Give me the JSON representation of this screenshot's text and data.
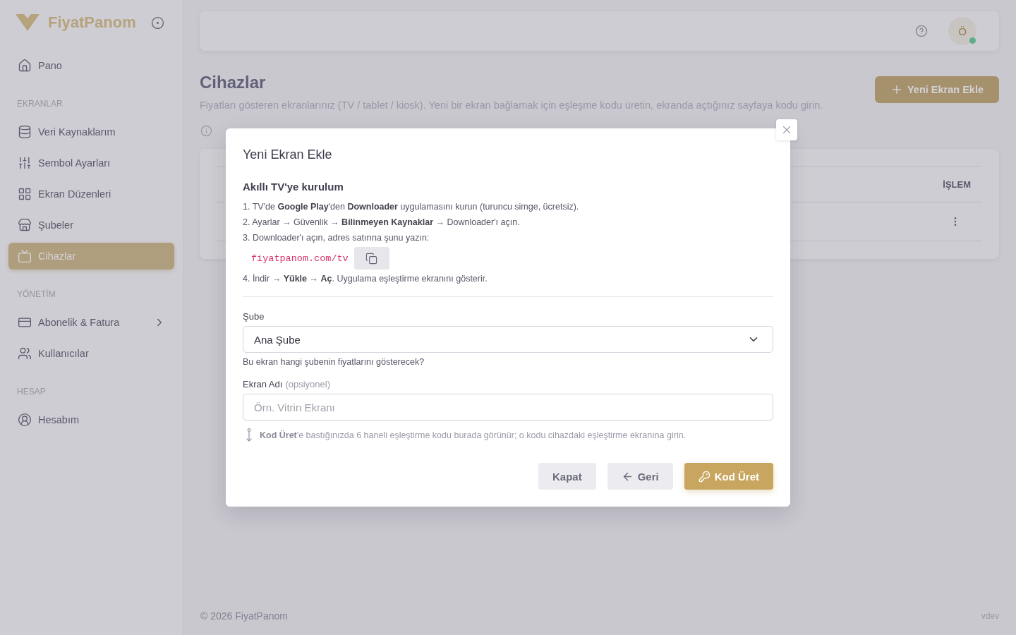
{
  "sidebar": {
    "brand": "FiyatPanom",
    "sections": [
      {
        "items": [
          {
            "label": "Pano",
            "kind": "link",
            "selected": false
          }
        ]
      },
      {
        "title": "EKRANLAR",
        "items": [
          {
            "label": "Veri Kaynaklarım",
            "kind": "link",
            "selected": false
          },
          {
            "label": "Sembol Ayarları",
            "kind": "link",
            "selected": false
          },
          {
            "label": "Ekran Düzenleri",
            "kind": "link",
            "selected": false
          },
          {
            "label": "Şubeler",
            "kind": "link",
            "selected": false
          },
          {
            "label": "Cihazlar",
            "kind": "link",
            "selected": true
          }
        ]
      },
      {
        "title": "YÖNETİM",
        "items": [
          {
            "label": "Abonelik & Fatura",
            "kind": "group",
            "selected": false,
            "expanded": false
          },
          {
            "label": "Kullanıcılar",
            "kind": "link",
            "selected": false
          }
        ]
      },
      {
        "title": "HESAP",
        "items": [
          {
            "label": "Hesabım",
            "kind": "link",
            "selected": false
          }
        ]
      }
    ]
  },
  "topbar": {
    "user": {
      "initial": "Ö",
      "online": true
    }
  },
  "page": {
    "title": "Cihazlar",
    "subtitle": "Fiyatları gösteren ekranlarınız (TV / tablet / kiosk). Yeni bir ekran bağlamak için eşleşme kodu üretin, ekranda açtığınız sayfaya kodu girin.",
    "add_button": {
      "label": "Yeni Ekran Ekle",
      "disabled": true
    }
  },
  "table": {
    "columns": [
      {
        "label": "İŞLEM"
      }
    ],
    "rows": [
      {
        "actions_menu": true
      }
    ]
  },
  "modal": {
    "title": "Yeni Ekran Ekle",
    "section_title": "Akıllı TV'ye kurulum",
    "steps": [
      {
        "text": "1. TV'de **Google Play**'den **Downloader** uygulamasını kurun (turuncu simge, ücretsiz)."
      },
      {
        "text": "2. Ayarlar → Güvenlik → **Bilinmeyen Kaynaklar** → Downloader'ı açın."
      },
      {
        "text": "3. Downloader'ı açın, adres satırına şunu yazın:",
        "code": "fiyatpanom.com/tv"
      },
      {
        "text": "4. İndir → **Yükle** → **Aç**. Uygulama eşleştirme ekranını gösterir."
      }
    ],
    "branch": {
      "label": "Şube",
      "value": "Ana Şube",
      "help": "Bu ekran hangi şubenin fiyatlarını gösterecek?"
    },
    "screen_name": {
      "label": "Ekran Adı",
      "note": "(opsiyonel)",
      "placeholder": "Örn. Vitrin Ekranı"
    },
    "hint": "**Kod Üret**'e bastığınızda 6 haneli eşleştirme kodu burada görünür; o kodu cihazdaki eşleştirme ekranına girin.",
    "buttons": [
      {
        "label": "Kapat",
        "kind": "secondary"
      },
      {
        "label": "Geri",
        "kind": "back"
      },
      {
        "label": "Kod Üret",
        "kind": "primary"
      }
    ]
  },
  "footer": {
    "copyright": "© 2026 FiyatPanom",
    "version": "vdev"
  }
}
